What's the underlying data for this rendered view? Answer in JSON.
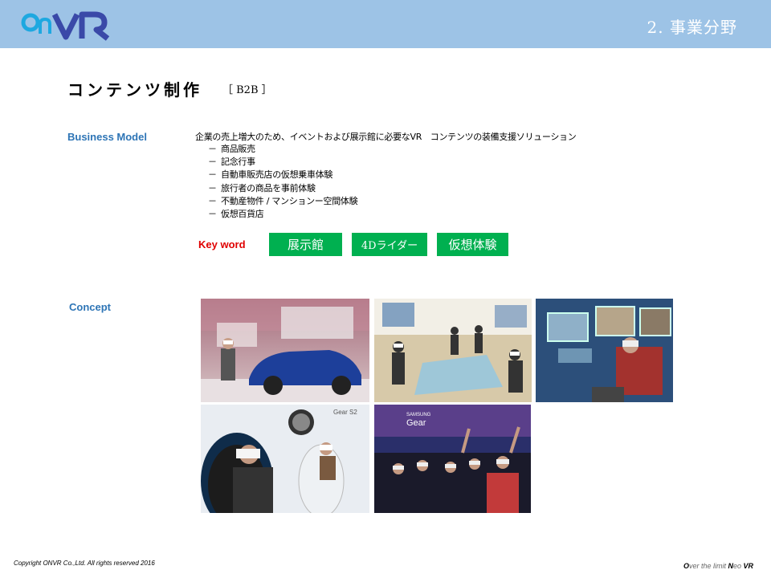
{
  "header": {
    "logo_text": "OnVR",
    "section_title": "2. 事業分野",
    "logo_color": "#3a49a8",
    "logo_accent": "#1ea8e0",
    "bar_color": "#9dc3e6"
  },
  "page": {
    "title": "コンテンツ制作",
    "tag": "［ B2B ］"
  },
  "business_model": {
    "label": "Business Model",
    "intro": "企業の売上増大のため、イベントおよび展示館に必要なVR　コンテンツの装備支援ソリューション",
    "dash": "－",
    "items": [
      "商品販売",
      "記念行事",
      "自動車販売店の仮想乗車体験",
      "旅行者の商品を事前体験",
      "不動産物件 / マンションー空間体験",
      "仮想百貨店"
    ]
  },
  "keywords": {
    "label": "Key word",
    "items": [
      "展示館",
      "4Dライダー",
      "仮想体験"
    ],
    "color": "#00b050"
  },
  "concept": {
    "label": "Concept",
    "photos": [
      {
        "icon": "car-showroom-vr-photo"
      },
      {
        "icon": "exhibition-vr-photo"
      },
      {
        "icon": "virtual-house-vr-photo"
      },
      {
        "icon": "gear-s2-vr-chair-photo",
        "caption": "Gear S2"
      },
      {
        "icon": "samsung-gear-vr-crowd-photo",
        "caption": "SAMSUNG Gear"
      }
    ]
  },
  "footer": {
    "copyright": "Copyright  ONVR Co.,Ltd. All rights reserved 2016",
    "slogan_o": "O",
    "slogan_mid1": "ver the limit ",
    "slogan_n": "N",
    "slogan_mid2": "eo ",
    "slogan_vr": "VR"
  }
}
